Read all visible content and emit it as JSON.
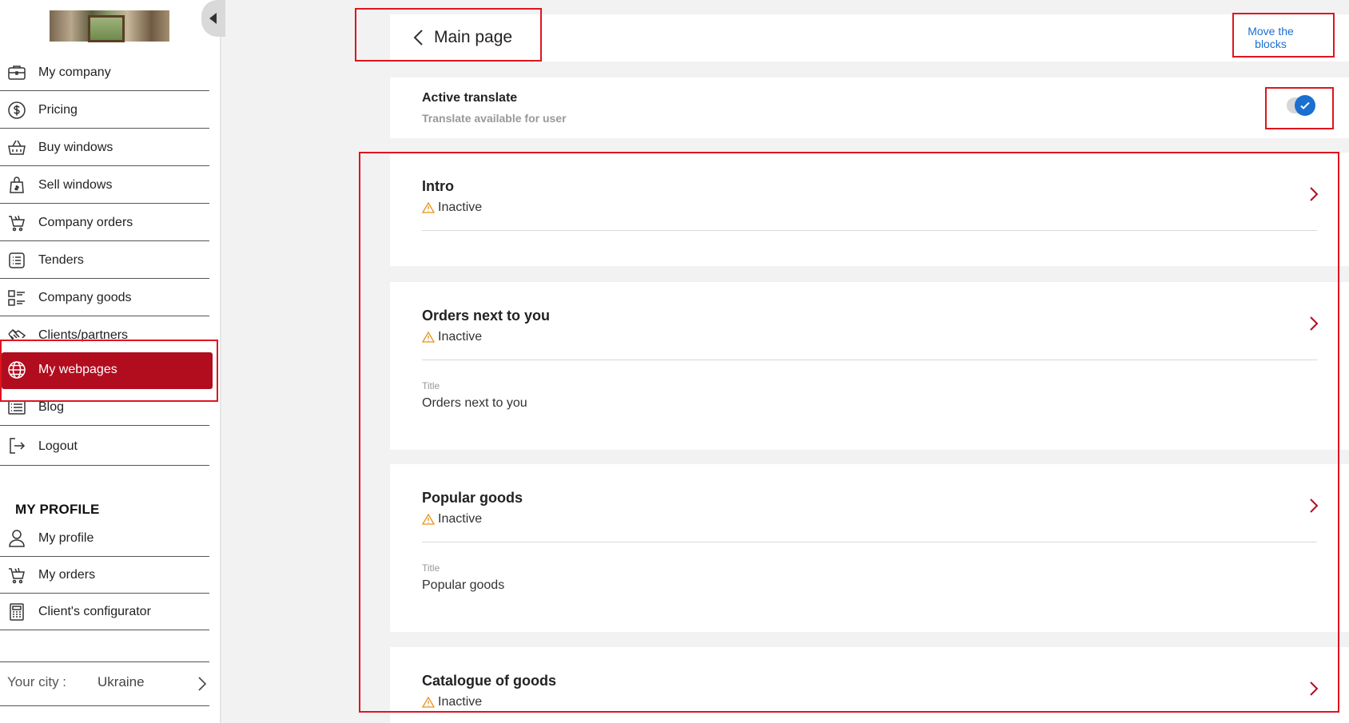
{
  "sidebar": {
    "items": [
      {
        "label": "My company",
        "icon": "briefcase-icon"
      },
      {
        "label": "Pricing",
        "icon": "dollar-coin-icon"
      },
      {
        "label": "Buy windows",
        "icon": "basket-icon"
      },
      {
        "label": "Sell windows",
        "icon": "shopping-bag-icon"
      },
      {
        "label": "Company orders",
        "icon": "cart-icon"
      },
      {
        "label": "Tenders",
        "icon": "list-icon"
      },
      {
        "label": "Company goods",
        "icon": "goods-list-icon"
      },
      {
        "label": "Clients/partners",
        "icon": "handshake-icon"
      },
      {
        "label": "My webpages",
        "icon": "globe-icon",
        "active": true
      },
      {
        "label": "Blog",
        "icon": "blog-icon"
      },
      {
        "label": "Logout",
        "icon": "logout-icon"
      }
    ],
    "profile_section_title": "MY PROFILE",
    "profile_items": [
      {
        "label": "My profile",
        "icon": "user-icon"
      },
      {
        "label": "My orders",
        "icon": "cart-icon"
      },
      {
        "label": "Client's configurator",
        "icon": "calculator-icon"
      }
    ],
    "city": {
      "label": "Your city :",
      "value": "Ukraine"
    }
  },
  "header": {
    "title": "Main page",
    "move_blocks": "Move the blocks"
  },
  "translate": {
    "title": "Active translate",
    "subtitle": "Translate available for user",
    "enabled": true
  },
  "blocks": [
    {
      "title": "Intro",
      "status": "Inactive"
    },
    {
      "title": "Orders next to you",
      "status": "Inactive",
      "field_label": "Title",
      "field_value": "Orders next to you"
    },
    {
      "title": "Popular goods",
      "status": "Inactive",
      "field_label": "Title",
      "field_value": "Popular goods"
    },
    {
      "title": "Catalogue of goods",
      "status": "Inactive"
    }
  ],
  "colors": {
    "accent_red": "#b10d1f",
    "link_blue": "#1a6fcf",
    "warning_orange": "#e8921e",
    "annotation_red": "#e0141e"
  }
}
